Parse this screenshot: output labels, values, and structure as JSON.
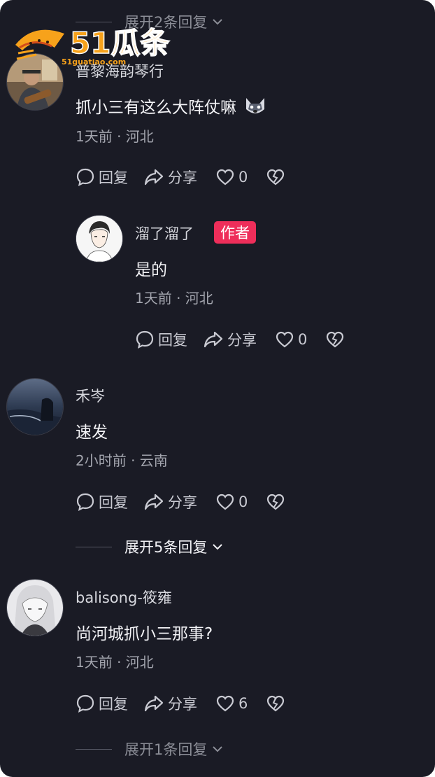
{
  "comments": {
    "top_expand": "展开2条回复",
    "c1": {
      "name": "普黎海韵琴行",
      "content": "抓小三有这么大阵仗嘛",
      "meta": "1天前 · 河北",
      "reply": "回复",
      "share": "分享",
      "likes": "0"
    },
    "r1": {
      "name": "溜了溜了",
      "badge": "作者",
      "content": "是的",
      "meta": "1天前 · 河北",
      "reply": "回复",
      "share": "分享",
      "likes": "0"
    },
    "c2": {
      "name": "禾岑",
      "content": "速发",
      "meta": "2小时前 · 云南",
      "reply": "回复",
      "share": "分享",
      "likes": "0"
    },
    "c2_expand": "展开5条回复",
    "c3": {
      "name": "balisong-筱雍",
      "content": "尚河城抓小三那事?",
      "meta": "1天前 · 河北",
      "reply": "回复",
      "share": "分享",
      "likes": "6"
    },
    "c3_expand": "展开1条回复"
  },
  "watermark": {
    "text": "51瓜条",
    "url": "51guatiao.com"
  },
  "colors": {
    "background": "#1a1b25",
    "badge": "#ee2e5a",
    "watermark": "#f7a21b"
  }
}
